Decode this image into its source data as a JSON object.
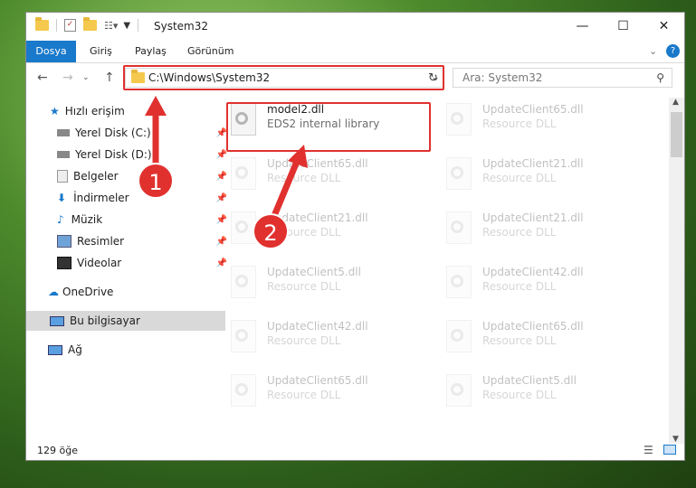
{
  "window": {
    "title": "System32",
    "minimize": "—",
    "maximize": "☐",
    "close": "✕"
  },
  "ribbon": {
    "tabs": [
      "Dosya",
      "Giriş",
      "Paylaş",
      "Görünüm"
    ],
    "help": "?"
  },
  "nav": {
    "address": "C:\\Windows\\System32",
    "search_placeholder": "Ara: System32"
  },
  "sidebar": {
    "items": [
      {
        "label": "Hızlı erişim",
        "icon": "star-icon"
      },
      {
        "label": "Yerel Disk (C:)",
        "icon": "drive-icon"
      },
      {
        "label": "Yerel Disk (D:)",
        "icon": "drive-icon"
      },
      {
        "label": "Belgeler",
        "icon": "documents-icon"
      },
      {
        "label": "İndirmeler",
        "icon": "download-icon"
      },
      {
        "label": "Müzik",
        "icon": "music-icon"
      },
      {
        "label": "Resimler",
        "icon": "pictures-icon"
      },
      {
        "label": "Videolar",
        "icon": "video-icon"
      },
      {
        "label": "OneDrive",
        "icon": "cloud-icon"
      },
      {
        "label": "Bu bilgisayar",
        "icon": "computer-icon"
      },
      {
        "label": "Ağ",
        "icon": "network-icon"
      }
    ]
  },
  "files": {
    "main": {
      "name": "model2.dll",
      "desc": "EDS2 internal library"
    },
    "items": [
      {
        "name": "UpdateClient65.dll",
        "desc": "Resource DLL"
      },
      {
        "name": "UpdateClient65.dll",
        "desc": "Resource DLL"
      },
      {
        "name": "UpdateClient21.dll",
        "desc": "Resource DLL"
      },
      {
        "name": "UpdateClient21.dll",
        "desc": "Resource DLL"
      },
      {
        "name": "UpdateClient21.dll",
        "desc": "Resource DLL"
      },
      {
        "name": "UpdateClient5.dll",
        "desc": "Resource DLL"
      },
      {
        "name": "UpdateClient42.dll",
        "desc": "Resource DLL"
      },
      {
        "name": "UpdateClient42.dll",
        "desc": "Resource DLL"
      },
      {
        "name": "UpdateClient65.dll",
        "desc": "Resource DLL"
      },
      {
        "name": "UpdateClient65.dll",
        "desc": "Resource DLL"
      },
      {
        "name": "UpdateClient5.dll",
        "desc": "Resource DLL"
      }
    ]
  },
  "status": {
    "count": "129 öğe"
  },
  "callouts": {
    "one": "1",
    "two": "2"
  },
  "colors": {
    "accent": "#1979ca",
    "highlight": "#e0312f"
  }
}
